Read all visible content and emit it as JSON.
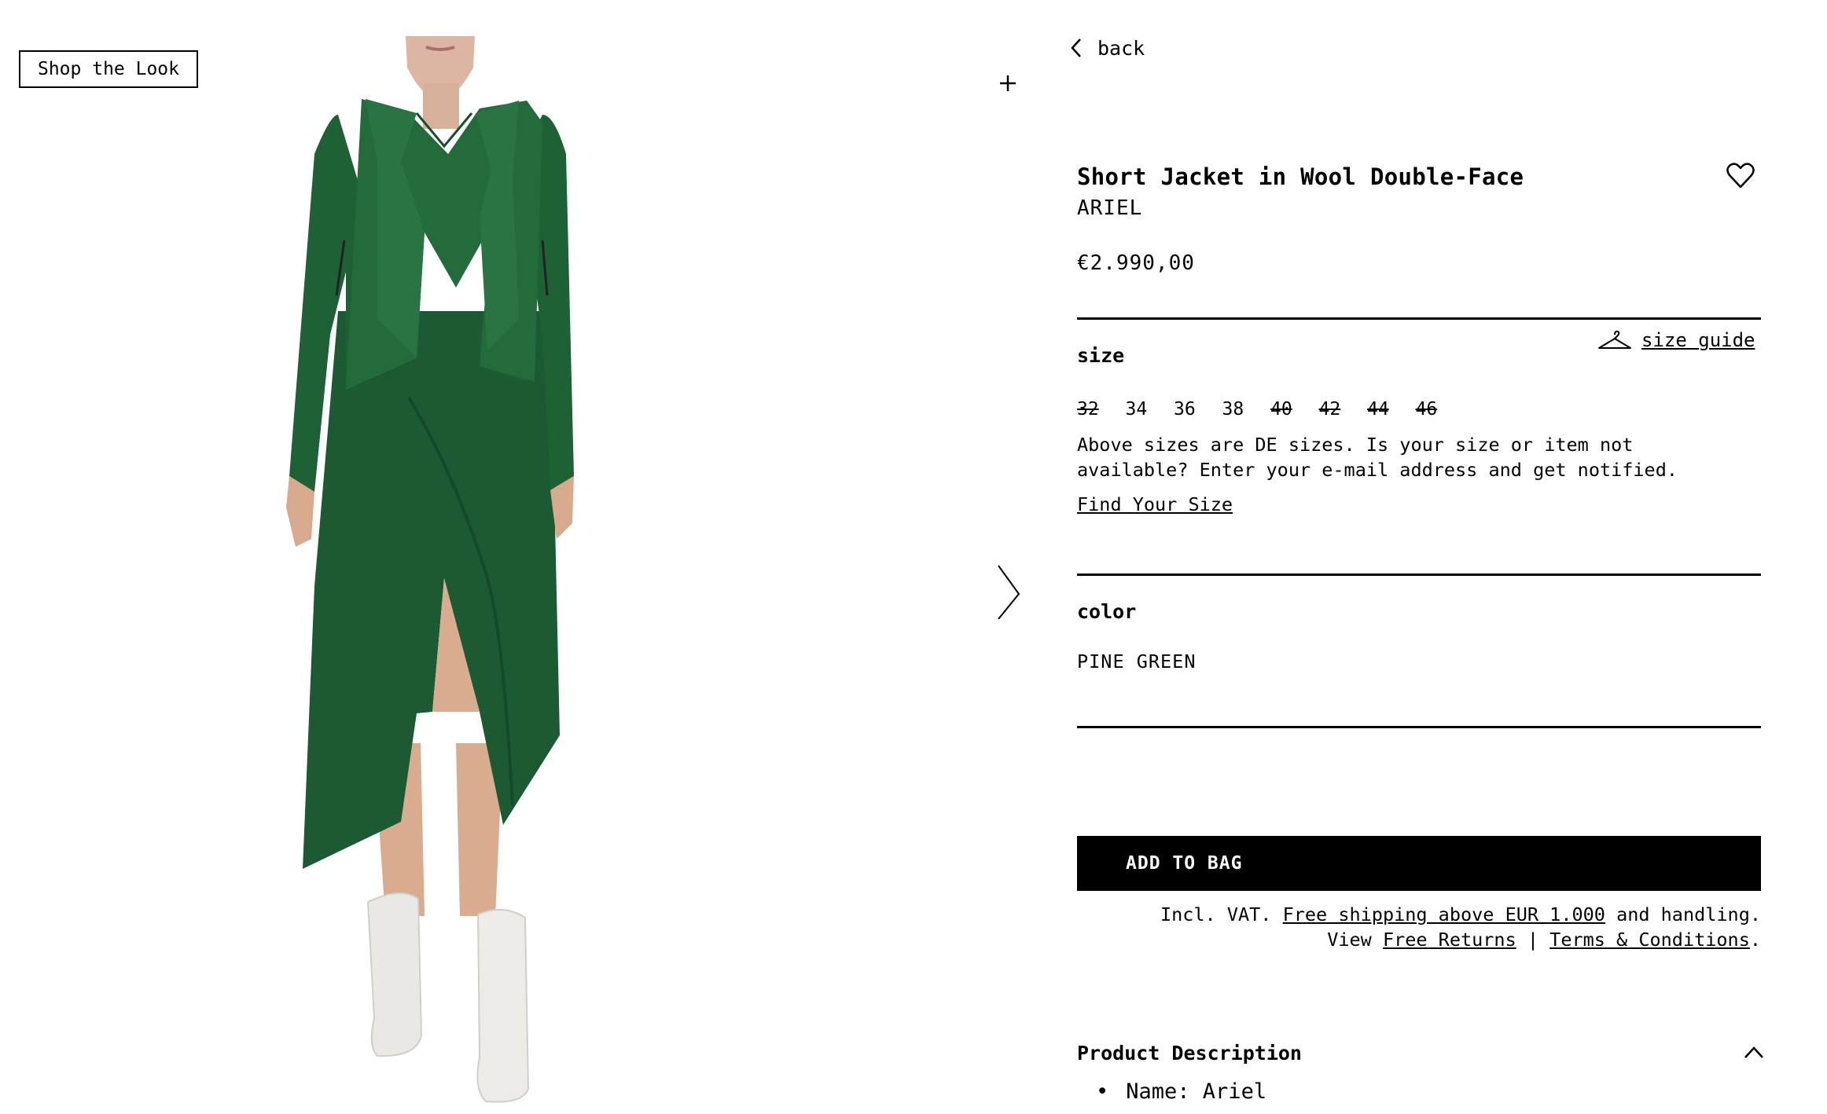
{
  "gallery": {
    "shop_the_look_label": "Shop the Look",
    "zoom_icon": "plus-icon",
    "next_icon": "chevron-right-icon",
    "image_subject": "model-wearing-green-jacket-and-dress"
  },
  "nav": {
    "back_label": "back",
    "back_icon": "chevron-left-icon"
  },
  "product": {
    "title": "Short Jacket in Wool Double-Face",
    "brand": "ARIEL",
    "price": "€2.990,00",
    "wishlist_icon": "heart-icon"
  },
  "size": {
    "label": "size",
    "guide_label": "size guide",
    "guide_icon": "hanger-icon",
    "options": [
      {
        "label": "32",
        "available": false
      },
      {
        "label": "34",
        "available": true
      },
      {
        "label": "36",
        "available": true
      },
      {
        "label": "38",
        "available": true
      },
      {
        "label": "40",
        "available": false
      },
      {
        "label": "42",
        "available": false
      },
      {
        "label": "44",
        "available": false
      },
      {
        "label": "46",
        "available": false
      }
    ],
    "note": "Above sizes are DE sizes. Is your size or item not available? Enter your e-mail address and get notified.",
    "find_size_label": "Find Your Size"
  },
  "color": {
    "label": "color",
    "value": "PINE GREEN",
    "swatch": "#1d5a34"
  },
  "purchase": {
    "add_to_bag_label": "ADD TO BAG",
    "ship_prefix": "Incl. VAT. ",
    "ship_link": "Free shipping above EUR 1.000",
    "ship_suffix": " and handling.",
    "view_prefix": "View ",
    "returns_link": "Free Returns",
    "separator": " | ",
    "terms_link": "Terms & Conditions",
    "terms_suffix": "."
  },
  "description": {
    "title": "Product Description",
    "toggle_icon": "chevron-up-icon",
    "items": [
      "Name: Ariel"
    ]
  }
}
